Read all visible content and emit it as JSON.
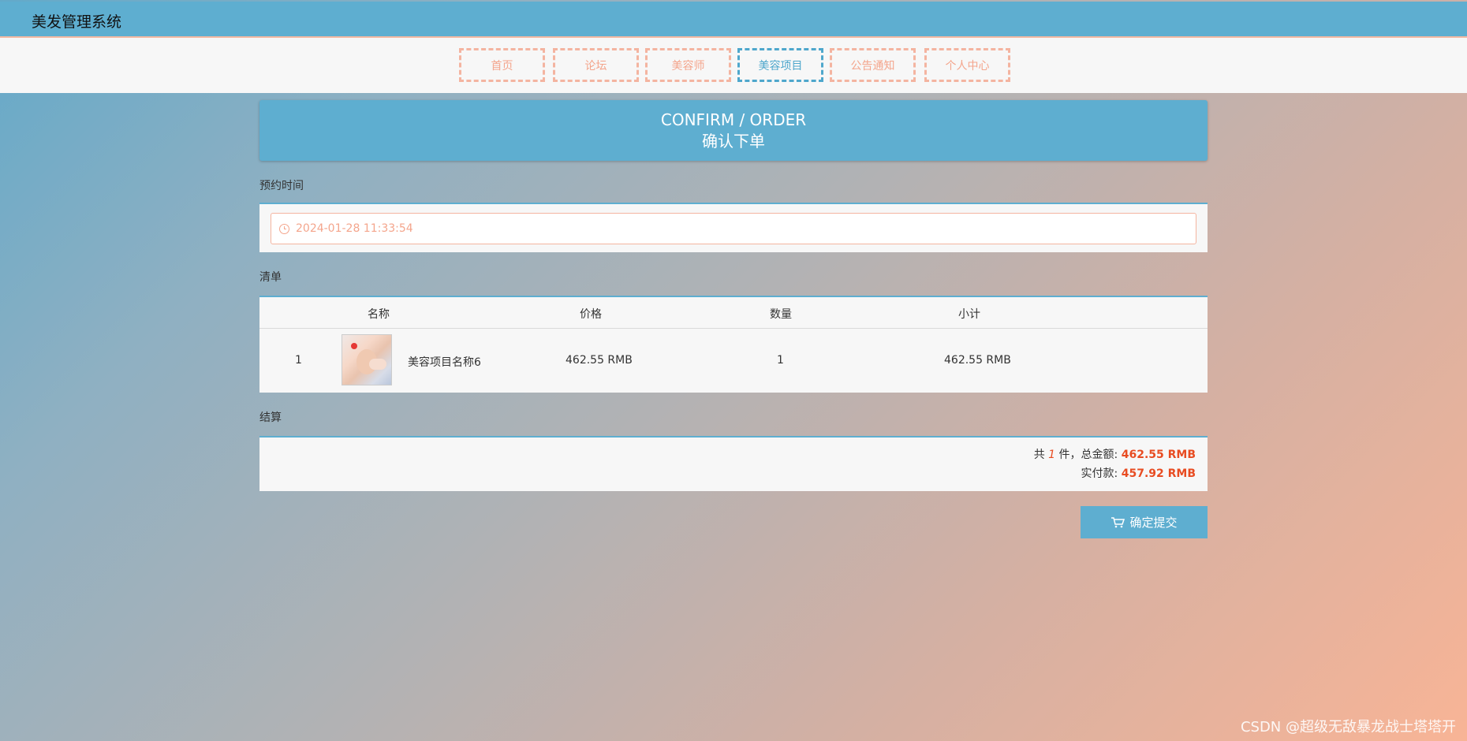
{
  "app": {
    "title": "美发管理系统"
  },
  "nav": {
    "items": [
      {
        "label": "首页"
      },
      {
        "label": "论坛"
      },
      {
        "label": "美容师"
      },
      {
        "label": "美容项目"
      },
      {
        "label": "公告通知"
      },
      {
        "label": "个人中心"
      }
    ],
    "active": "美容项目",
    "accent_color": "#f4b4a0",
    "active_color": "#4ea7cc"
  },
  "banner": {
    "title_en": "CONFIRM / ORDER",
    "title_cn": "确认下单"
  },
  "appointment": {
    "label": "预约时间",
    "value": "2024-01-28 11:33:54",
    "icon": "clock-icon"
  },
  "list": {
    "label": "清单",
    "columns": [
      "名称",
      "价格",
      "数量",
      "小计"
    ],
    "rows": [
      {
        "index": "1",
        "name": "美容项目名称6",
        "price": "462.55 RMB",
        "qty": "1",
        "subtotal": "462.55 RMB"
      }
    ]
  },
  "settlement": {
    "label": "结算",
    "prefix_count": "共",
    "count": "1",
    "suffix_count": "件，总金额:",
    "total": "462.55 RMB",
    "paid_label": "实付款:",
    "paid": "457.92 RMB",
    "highlight_color": "#e84c22"
  },
  "actions": {
    "submit_label": "确定提交",
    "submit_icon": "cart-icon"
  },
  "watermark": "CSDN @超级无敌暴龙战士塔塔开"
}
